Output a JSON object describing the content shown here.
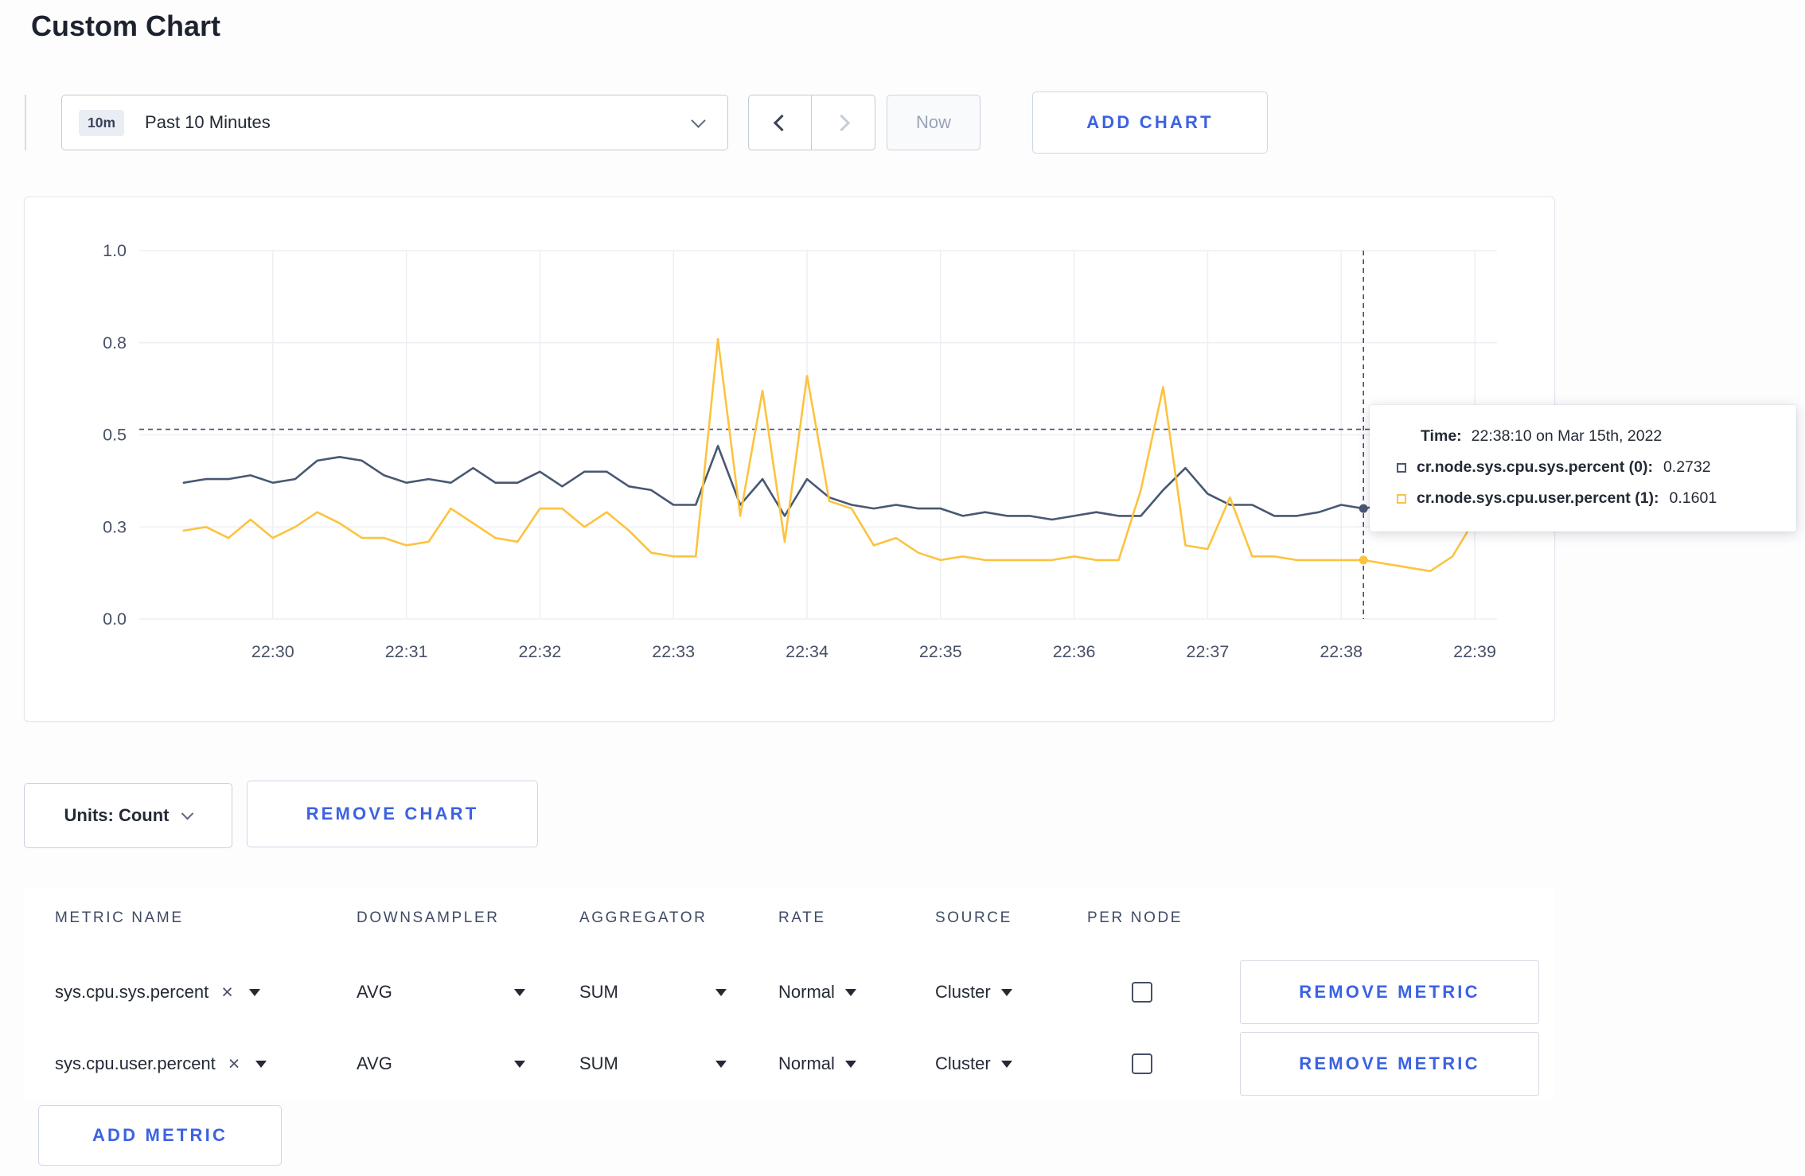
{
  "page": {
    "title": "Custom Chart"
  },
  "colors": {
    "accent_blue": "#3c62e2",
    "grid": "#edeff4",
    "axis_text": "#475066",
    "dashed_line": "#45506b"
  },
  "toolbar": {
    "range_badge": "10m",
    "range_label": "Past 10 Minutes",
    "now_label": "Now",
    "add_chart_label": "ADD CHART"
  },
  "chart_card": {
    "tooltip": {
      "time_label": "Time:",
      "time_value": "22:38:10 on Mar 15th, 2022",
      "rows": [
        {
          "label": "cr.node.sys.cpu.sys.percent (0):",
          "value": "0.2732"
        },
        {
          "label": "cr.node.sys.cpu.user.percent (1):",
          "value": "0.1601"
        }
      ]
    }
  },
  "chart_data": {
    "type": "line",
    "title": "",
    "xlabel": "",
    "ylabel": "",
    "ylim": [
      0,
      1
    ],
    "grid": true,
    "legend_position": "tooltip-only",
    "x_ticks": [
      "22:30",
      "22:31",
      "22:32",
      "22:33",
      "22:34",
      "22:35",
      "22:36",
      "22:37",
      "22:38",
      "22:39"
    ],
    "x_tick_sec": [
      0,
      60,
      120,
      180,
      240,
      300,
      360,
      420,
      480,
      540
    ],
    "y_ticks": [
      "1.0",
      "0.8",
      "0.5",
      "0.3",
      "0.0"
    ],
    "y_tick_values": [
      1,
      0.75,
      0.5,
      0.25,
      0
    ],
    "x_domain_sec": [
      -60,
      550
    ],
    "t0_sec": -40,
    "step_sec": 10,
    "threshold_value": 0.515,
    "hover_time_sec": 490,
    "hover_time_text": "22:38:10 on Mar 15th, 2022",
    "series": [
      {
        "name": "cr.node.sys.cpu.sys.percent",
        "color": "#475872",
        "hover_value": 0.2732,
        "values": [
          0.37,
          0.38,
          0.38,
          0.39,
          0.37,
          0.38,
          0.43,
          0.44,
          0.43,
          0.39,
          0.37,
          0.38,
          0.37,
          0.41,
          0.37,
          0.37,
          0.4,
          0.36,
          0.4,
          0.4,
          0.36,
          0.35,
          0.31,
          0.31,
          0.47,
          0.31,
          0.38,
          0.28,
          0.38,
          0.33,
          0.31,
          0.3,
          0.31,
          0.3,
          0.3,
          0.28,
          0.29,
          0.28,
          0.28,
          0.27,
          0.28,
          0.29,
          0.28,
          0.28,
          0.35,
          0.41,
          0.34,
          0.31,
          0.31,
          0.28,
          0.28,
          0.29,
          0.31,
          0.3,
          0.31,
          0.3,
          0.29,
          0.3,
          0.3,
          0.31,
          0.3
        ]
      },
      {
        "name": "cr.node.sys.cpu.user.percent",
        "color": "#fdc33f",
        "hover_value": 0.1601,
        "values": [
          0.24,
          0.25,
          0.22,
          0.27,
          0.22,
          0.25,
          0.29,
          0.26,
          0.22,
          0.22,
          0.2,
          0.21,
          0.3,
          0.26,
          0.22,
          0.21,
          0.3,
          0.3,
          0.25,
          0.29,
          0.24,
          0.18,
          0.17,
          0.17,
          0.76,
          0.28,
          0.62,
          0.21,
          0.66,
          0.32,
          0.3,
          0.2,
          0.22,
          0.18,
          0.16,
          0.17,
          0.16,
          0.16,
          0.16,
          0.16,
          0.17,
          0.16,
          0.16,
          0.35,
          0.63,
          0.2,
          0.19,
          0.33,
          0.17,
          0.17,
          0.16,
          0.16,
          0.16,
          0.16,
          0.15,
          0.14,
          0.13,
          0.17,
          0.27,
          0.28,
          0.24
        ]
      }
    ]
  },
  "units_row": {
    "units_label": "Units: Count",
    "remove_chart_label": "REMOVE CHART"
  },
  "metrics_table": {
    "headers": [
      "METRIC NAME",
      "DOWNSAMPLER",
      "AGGREGATOR",
      "RATE",
      "SOURCE",
      "PER NODE"
    ],
    "rows": [
      {
        "metric": "sys.cpu.sys.percent",
        "downsampler": "AVG",
        "aggregator": "SUM",
        "rate": "Normal",
        "source": "Cluster",
        "per_node_checked": false,
        "remove_label": "REMOVE METRIC"
      },
      {
        "metric": "sys.cpu.user.percent",
        "downsampler": "AVG",
        "aggregator": "SUM",
        "rate": "Normal",
        "source": "Cluster",
        "per_node_checked": false,
        "remove_label": "REMOVE METRIC"
      }
    ],
    "add_metric_label": "ADD METRIC"
  }
}
